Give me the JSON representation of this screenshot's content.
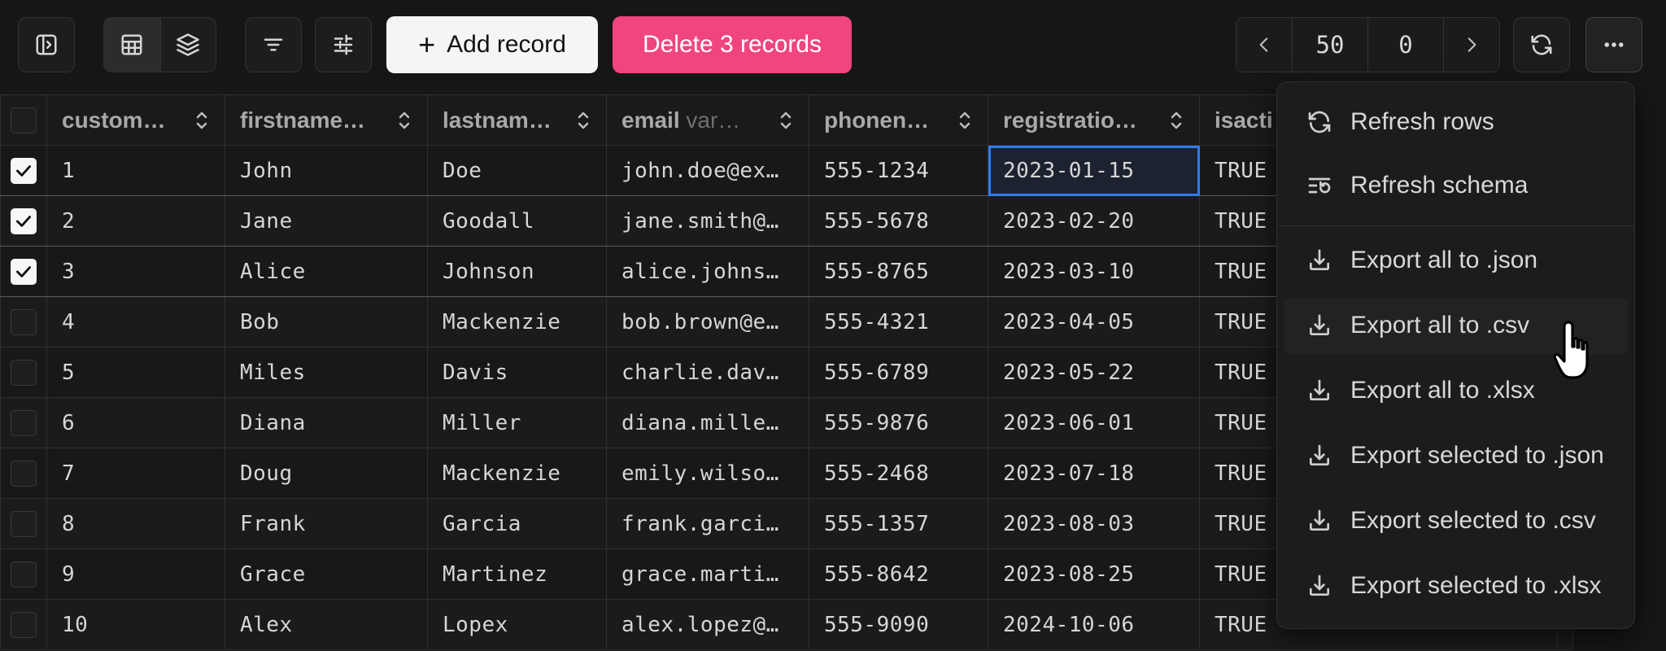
{
  "toolbar": {
    "add_label": "Add record",
    "delete_label": "Delete 3 records",
    "page_size": "50",
    "offset": "0"
  },
  "table": {
    "columns": [
      {
        "name": "custom…",
        "type": ""
      },
      {
        "name": "firstname…",
        "type": ""
      },
      {
        "name": "lastnam…",
        "type": ""
      },
      {
        "name": "email",
        "type": "var…"
      },
      {
        "name": "phonen…",
        "type": ""
      },
      {
        "name": "registratio…",
        "type": ""
      },
      {
        "name": "isacti",
        "type": ""
      }
    ],
    "rows": [
      {
        "checked": true,
        "c": [
          "1",
          "John",
          "Doe",
          "john.doe@ex…",
          "555-1234",
          "2023-01-15",
          "TRUE"
        ]
      },
      {
        "checked": true,
        "c": [
          "2",
          "Jane",
          "Goodall",
          "jane.smith@…",
          "555-5678",
          "2023-02-20",
          "TRUE"
        ]
      },
      {
        "checked": true,
        "c": [
          "3",
          "Alice",
          "Johnson",
          "alice.johns…",
          "555-8765",
          "2023-03-10",
          "TRUE"
        ]
      },
      {
        "checked": false,
        "c": [
          "4",
          "Bob",
          "Mackenzie",
          "bob.brown@e…",
          "555-4321",
          "2023-04-05",
          "TRUE"
        ]
      },
      {
        "checked": false,
        "c": [
          "5",
          "Miles",
          "Davis",
          "charlie.dav…",
          "555-6789",
          "2023-05-22",
          "TRUE"
        ]
      },
      {
        "checked": false,
        "c": [
          "6",
          "Diana",
          "Miller",
          "diana.mille…",
          "555-9876",
          "2023-06-01",
          "TRUE"
        ]
      },
      {
        "checked": false,
        "c": [
          "7",
          "Doug",
          "Mackenzie",
          "emily.wilso…",
          "555-2468",
          "2023-07-18",
          "TRUE"
        ]
      },
      {
        "checked": false,
        "c": [
          "8",
          "Frank",
          "Garcia",
          "frank.garci…",
          "555-1357",
          "2023-08-03",
          "TRUE"
        ]
      },
      {
        "checked": false,
        "c": [
          "9",
          "Grace",
          "Martinez",
          "grace.marti…",
          "555-8642",
          "2023-08-25",
          "TRUE"
        ]
      },
      {
        "checked": false,
        "c": [
          "10",
          "Alex",
          "Lopex",
          "alex.lopez@…",
          "555-9090",
          "2024-10-06",
          "TRUE"
        ]
      }
    ]
  },
  "menu": {
    "items": [
      {
        "label": "Refresh rows",
        "icon": "refresh-icon"
      },
      {
        "label": "Refresh schema",
        "icon": "refresh-schema-icon"
      },
      {
        "label": "Export all to .json",
        "icon": "download-icon"
      },
      {
        "label": "Export all to .csv",
        "icon": "download-icon"
      },
      {
        "label": "Export all to .xlsx",
        "icon": "download-icon"
      },
      {
        "label": "Export selected to .json",
        "icon": "download-icon"
      },
      {
        "label": "Export selected to .csv",
        "icon": "download-icon"
      },
      {
        "label": "Export selected to .xlsx",
        "icon": "download-icon"
      }
    ]
  },
  "colors": {
    "accent_delete": "#f0457f",
    "focus_outline": "#2d7df0",
    "background": "#161616"
  }
}
